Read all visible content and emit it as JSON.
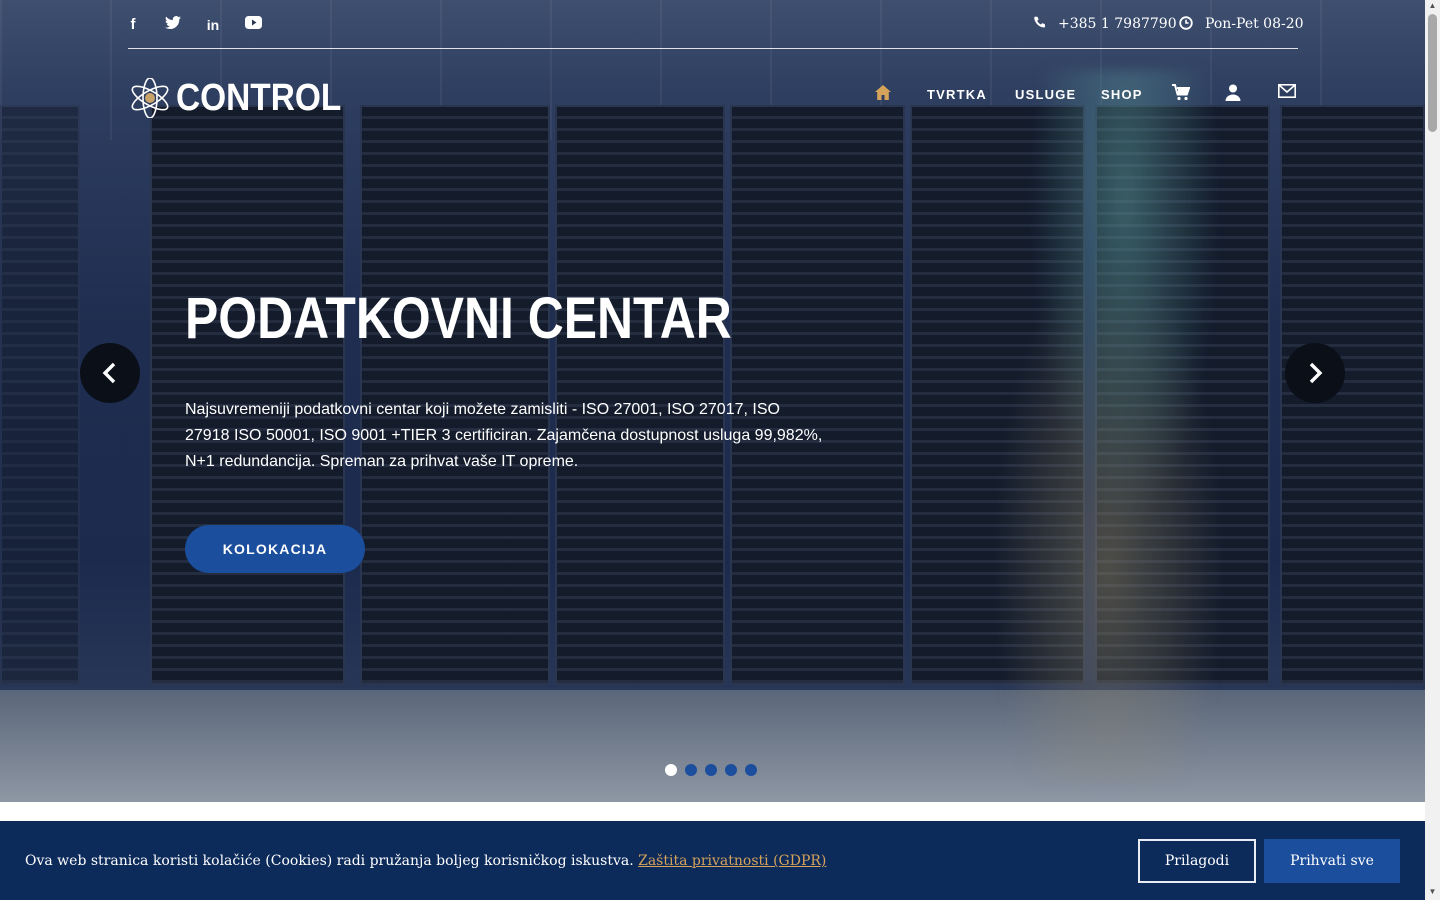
{
  "social": [
    {
      "name": "facebook",
      "glyph": "f"
    },
    {
      "name": "twitter",
      "glyph": "t"
    },
    {
      "name": "linkedin",
      "glyph": "in"
    },
    {
      "name": "youtube",
      "glyph": "▶"
    }
  ],
  "contact": {
    "phone": "+385 1 7987790",
    "hours": "Pon-Pet 08-20"
  },
  "logo": {
    "text": "CONTROL"
  },
  "nav": {
    "home_icon": "home-icon",
    "items": [
      "TVRTKA",
      "USLUGE",
      "SHOP"
    ],
    "cart_icon": "cart-icon",
    "user_icon": "user-icon",
    "mail_icon": "mail-icon",
    "home_color": "#d6a35a"
  },
  "hero": {
    "title": "PODATKOVNI CENTAR",
    "description": "Najsuvremeniji podatkovni centar koji možete zamisliti - ISO 27001, ISO 27017, ISO 27918 ISO 50001, ISO 9001 +TIER 3 certificiran. Zajamčena dostupnost usluga 99,982%, N+1 redundancija. Spreman za prihvat vaše IT opreme.",
    "cta": "KOLOKACIJA",
    "slide_count": 5,
    "active_slide": 1
  },
  "cookie": {
    "text": "Ova web stranica koristi kolačiće (Cookies) radi pružanja boljeg korisničkog iskustva. ",
    "link": "Zaštita privatnosti (GDPR)",
    "customize": "Prilagodi",
    "accept": "Prihvati sve"
  },
  "colors": {
    "accent": "#1b4e9c",
    "cookie_bg": "#0c2a5a",
    "link": "#d6a35a"
  }
}
